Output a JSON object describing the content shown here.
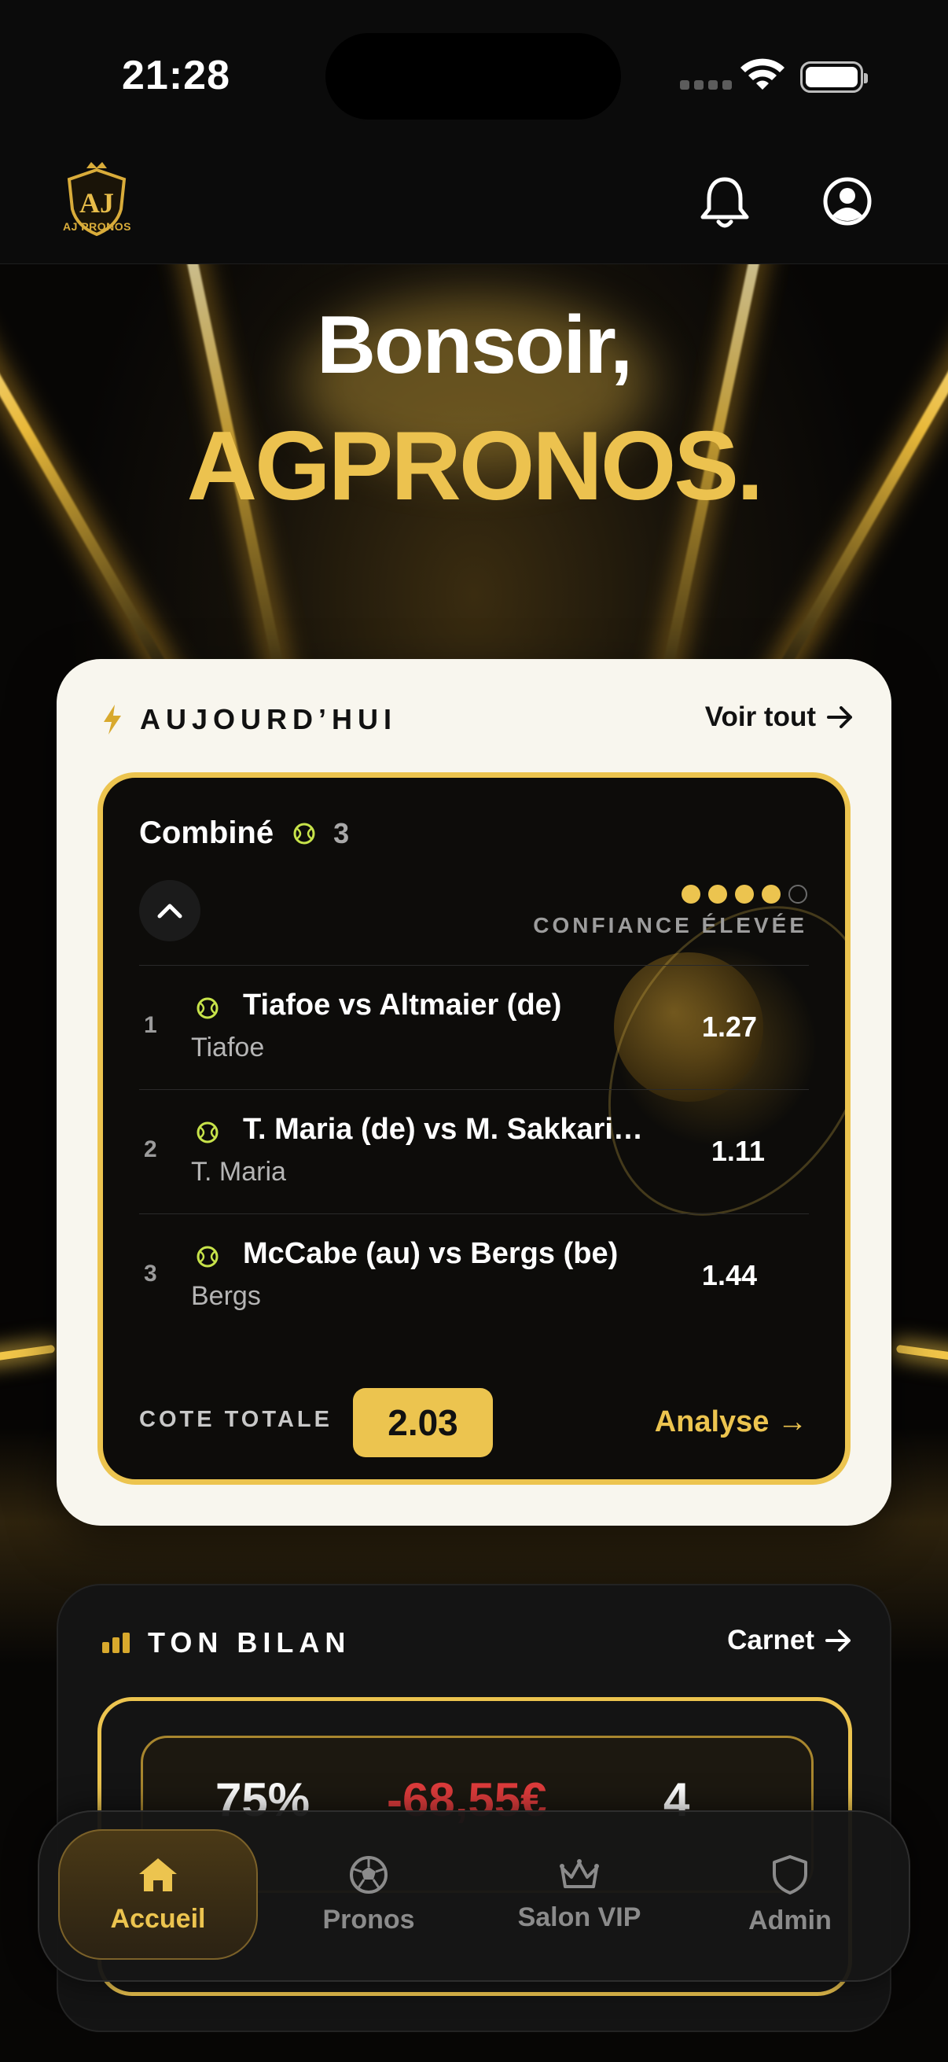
{
  "status_bar": {
    "time": "21:28"
  },
  "header": {
    "logo_text": "AJ PRONOS",
    "logo_monogram": "AJ",
    "icons": [
      "bell-icon",
      "user-circle-icon"
    ]
  },
  "greeting": {
    "line1": "Bonsoir,",
    "line2": "AGPRONOS."
  },
  "today": {
    "title": "AUJOURD’HUI",
    "see_all": "Voir tout",
    "combo": {
      "title": "Combiné",
      "count": "3",
      "confidence_label": "CONFIANCE ÉLEVÉE",
      "confidence_level": 4,
      "confidence_max": 5,
      "legs": [
        {
          "num": "1",
          "match": "Tiafoe vs Altmaier (de)",
          "pick": "Tiafoe",
          "odd": "1.27"
        },
        {
          "num": "2",
          "match": "T. Maria (de) vs M. Sakkari…",
          "pick": "T. Maria",
          "odd": "1.11"
        },
        {
          "num": "3",
          "match": "McCabe (au) vs Bergs (be)",
          "pick": "Bergs",
          "odd": "1.44"
        }
      ],
      "total_label": "COTE TOTALE",
      "total_odd": "2.03",
      "analyse": "Analyse →"
    }
  },
  "bilan": {
    "title": "TON BILAN",
    "link": "Carnet",
    "stats": [
      "75%",
      "-68,55€",
      "4"
    ]
  },
  "tabbar": {
    "tabs": [
      {
        "label": "Accueil",
        "icon": "home-icon",
        "active": true
      },
      {
        "label": "Pronos",
        "icon": "soccer-ball-icon",
        "active": false
      },
      {
        "label": "Salon VIP",
        "icon": "crown-icon",
        "active": false
      },
      {
        "label": "Admin",
        "icon": "shield-icon",
        "active": false
      }
    ]
  },
  "colors": {
    "accent": "#ecc44f",
    "negative": "#e03c3c",
    "card_light": "#f8f6ee",
    "background": "#0a0907"
  }
}
